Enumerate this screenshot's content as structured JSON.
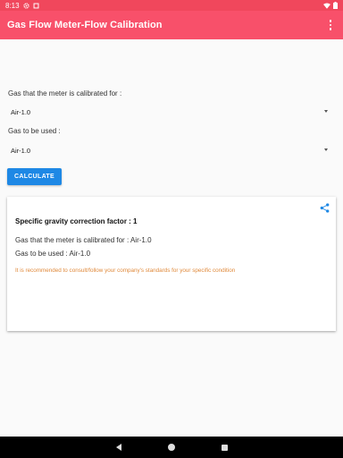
{
  "status_bar": {
    "time": "8:13"
  },
  "app_bar": {
    "title": "Gas Flow Meter-Flow Calibration"
  },
  "form": {
    "calibrated_for_label": "Gas that the meter is calibrated for :",
    "calibrated_for_value": "Air-1.0",
    "gas_used_label": "Gas to be used :",
    "gas_used_value": "Air-1.0",
    "calculate_label": "CALCULATE"
  },
  "result_card": {
    "title": "Specific gravity correction factor : 1",
    "calibrated_line": "Gas that the meter is calibrated for : Air-1.0",
    "used_line": "Gas to be used : Air-1.0",
    "note": "It is recommended to consult/follow your company's standards for your specific condition"
  },
  "colors": {
    "app_bar": "#f8506a",
    "button": "#1e88e5",
    "note_text": "#e08a3c",
    "share_icon": "#1e88e5"
  },
  "icons": [
    "settings-icon",
    "wifi-icon",
    "battery-icon",
    "overflow-menu-icon",
    "dropdown-arrow-icon",
    "share-icon",
    "back-icon",
    "home-icon",
    "recents-icon"
  ]
}
